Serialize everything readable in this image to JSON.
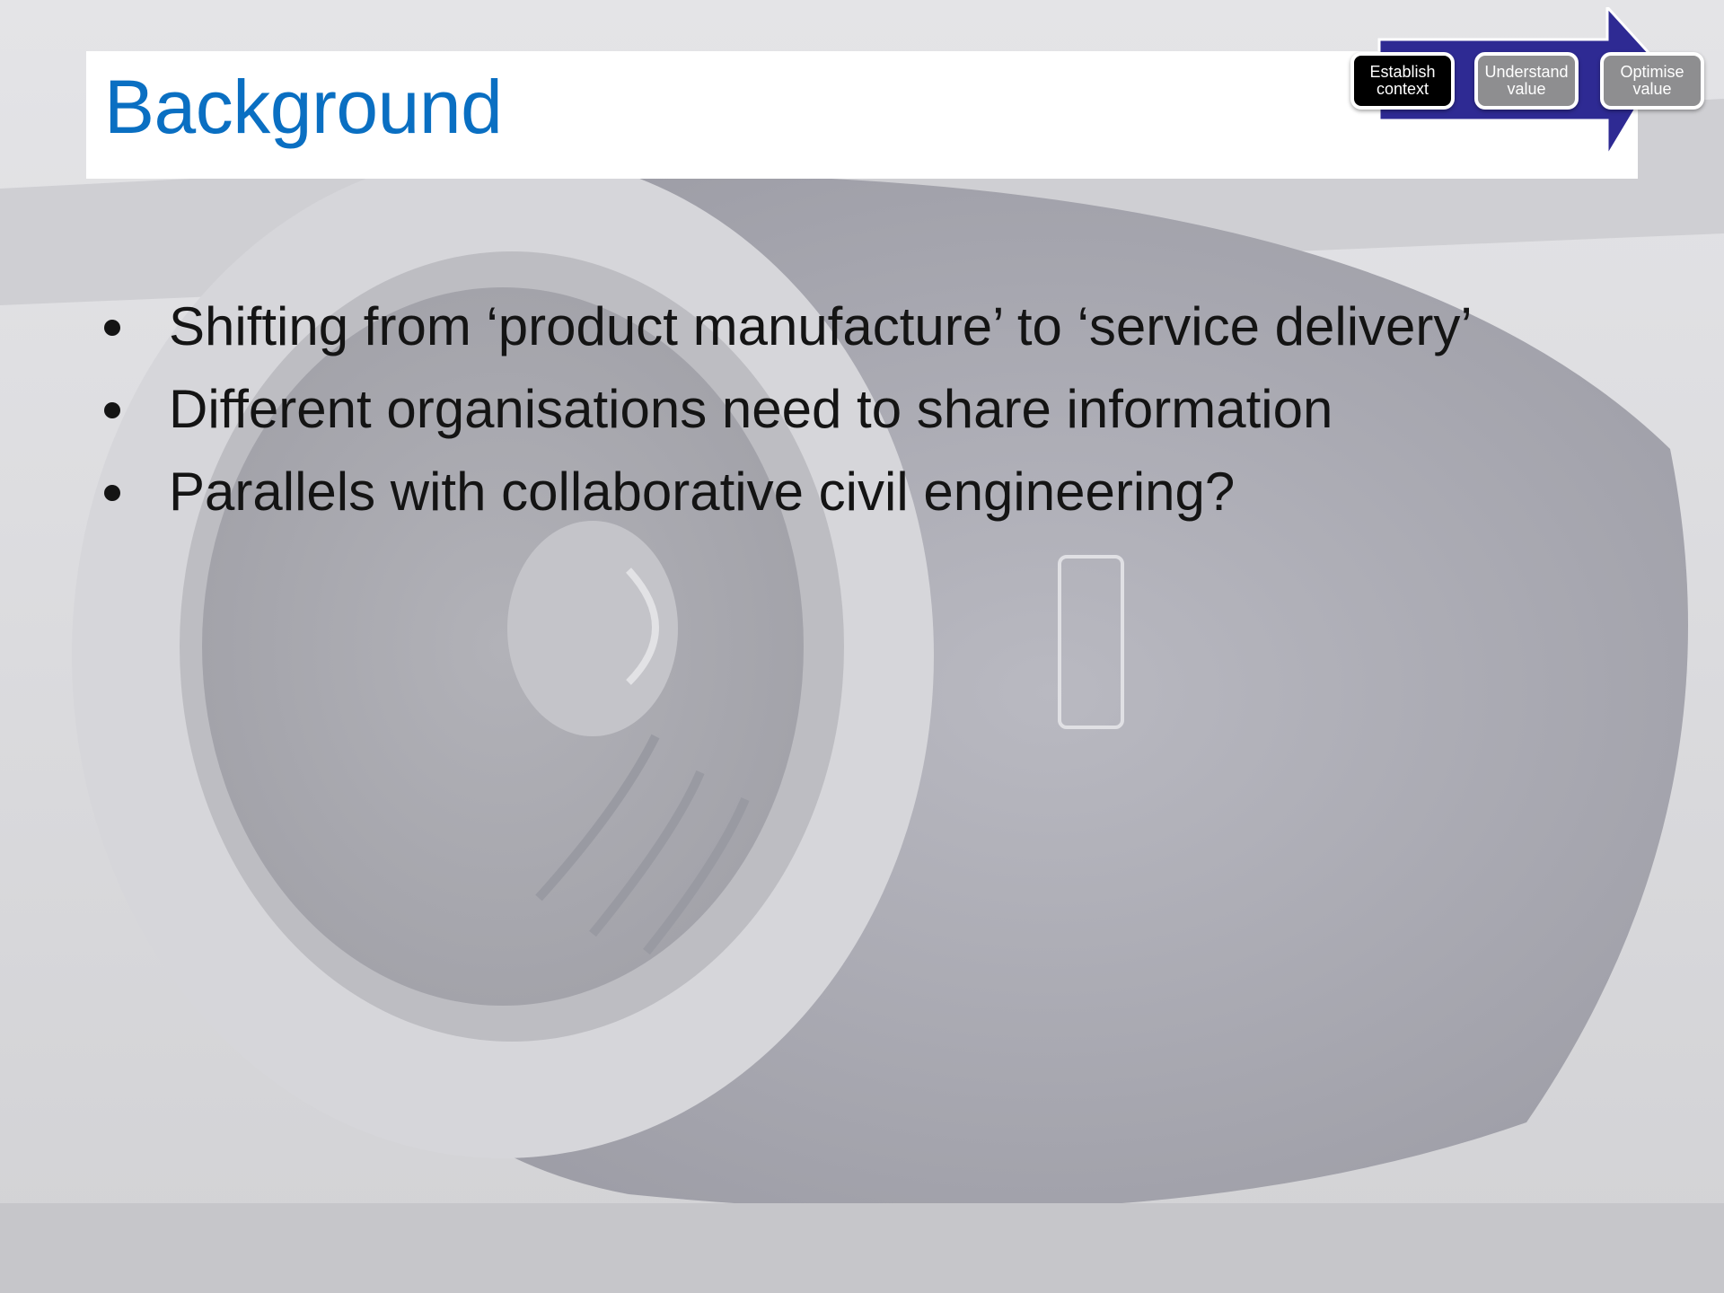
{
  "slide": {
    "title": "Background",
    "bullets": [
      "Shifting from ‘product manufacture’ to ‘service delivery’",
      "Different organisations need to share information",
      "Parallels with collaborative civil engineering?"
    ]
  },
  "progress_steps": [
    {
      "label": "Establish context",
      "state": "active"
    },
    {
      "label": "Understand value",
      "state": "inactive"
    },
    {
      "label": "Optimise value",
      "state": "inactive"
    }
  ],
  "colors": {
    "title": "#0a6fc2",
    "arrow": "#2e2a93",
    "active_step": "#000000",
    "inactive_step": "#8e8e90",
    "body_text": "#141414"
  }
}
